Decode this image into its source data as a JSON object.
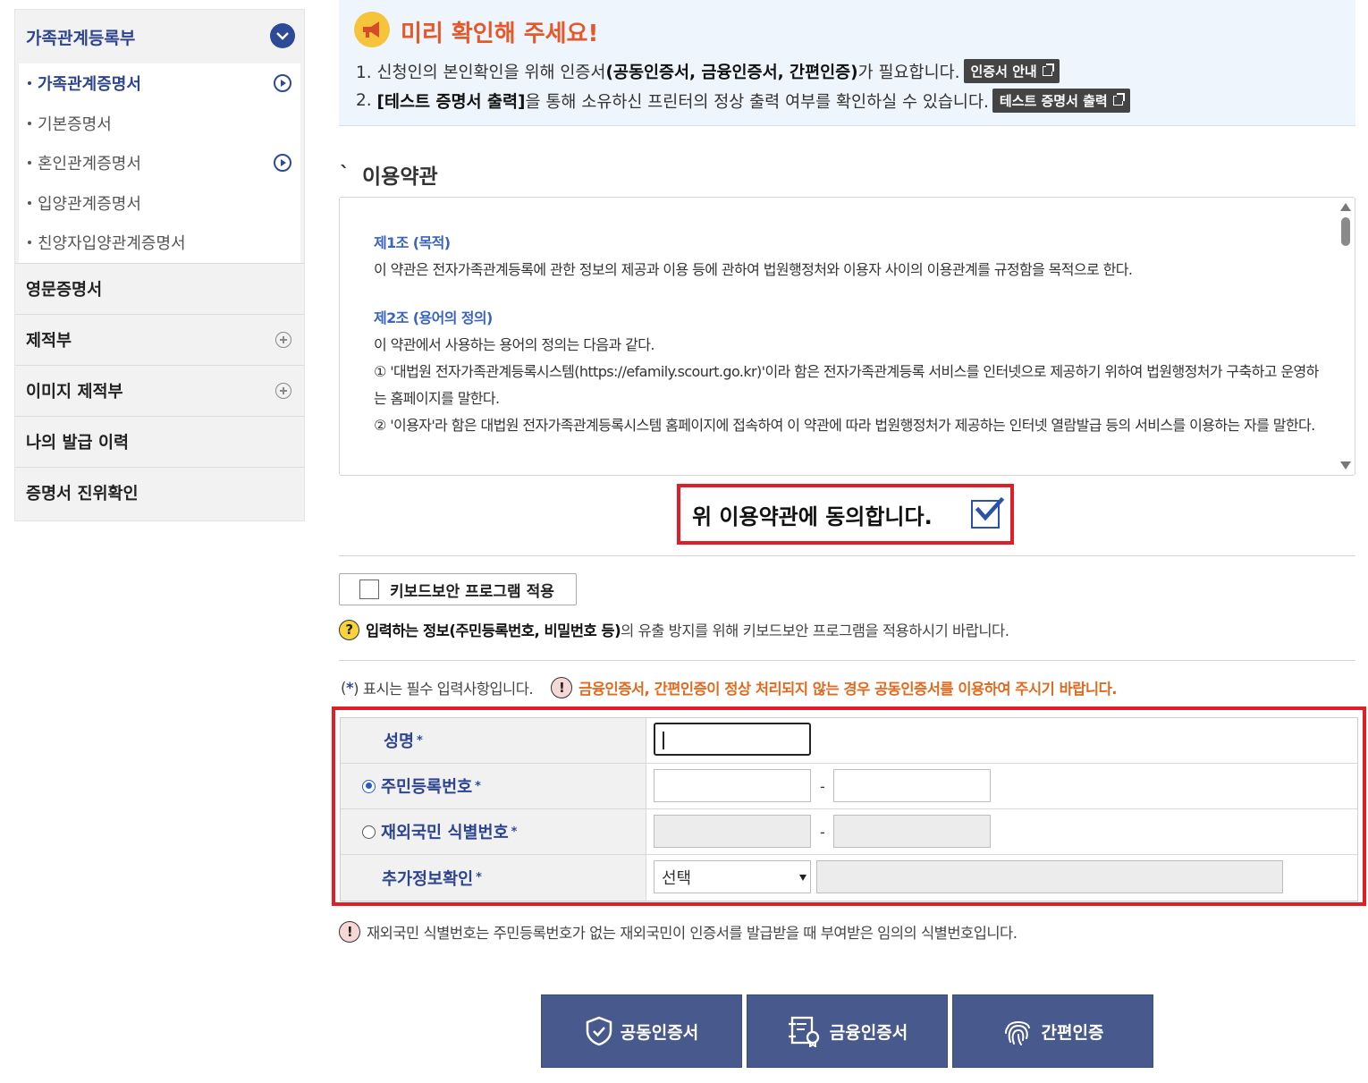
{
  "sidebar": {
    "header": "가족관계등록부",
    "sub_items": [
      {
        "label": "가족관계증명서"
      },
      {
        "label": "기본증명서"
      },
      {
        "label": "혼인관계증명서"
      },
      {
        "label": "입양관계증명서"
      },
      {
        "label": "친양자입양관계증명서"
      }
    ],
    "items": [
      {
        "label": "영문증명서"
      },
      {
        "label": "제적부"
      },
      {
        "label": "이미지 제적부"
      },
      {
        "label": "나의 발급 이력"
      },
      {
        "label": "증명서 진위확인"
      }
    ]
  },
  "notice": {
    "title": "미리 확인해 주세요!",
    "line1_a": "1. 신청인의 본인확인을 위해 인증서",
    "line1_b": "(공동인증서, 금융인증서, 간편인증)",
    "line1_c": "가 필요합니다.",
    "cert_guide_button": "인증서 안내",
    "line2_a": "2.",
    "line2_b": "[테스트 증명서 출력]",
    "line2_c": "을 통해 소유하신 프린터의 정상 출력 여부를 확인하실 수 있습니다.",
    "test_print_button": "테스트 증명서 출력"
  },
  "terms": {
    "section_title": "이용약관",
    "art1_title": "제1조 (목적)",
    "art1_body": "이 약관은 전자가족관계등록에 관한 정보의 제공과 이용 등에 관하여 법원행정처와 이용자 사이의 이용관계를 규정함을 목적으로 한다.",
    "art2_title": "제2조 (용어의 정의)",
    "art2_intro": "이 약관에서 사용하는 용어의 정의는 다음과 같다.",
    "art2_item1": "① '대법원 전자가족관계등록시스템(https://efamily.scourt.go.kr)'이라 함은 전자가족관계등록 서비스를 인터넷으로 제공하기 위하여 법원행정처가 구축하고 운영하는 홈페이지를 말한다.",
    "art2_item2": "② '이용자'라 함은 대법원 전자가족관계등록시스템 홈페이지에 접속하여 이 약관에 따라 법원행정처가 제공하는 인터넷 열람발급 등의 서비스를 이용하는 자를 말한다."
  },
  "agree": {
    "label": "위 이용약관에 동의합니다.",
    "checked": true
  },
  "keyboard": {
    "button_label": "키보드보안 프로그램 적용",
    "note_bold": "입력하는 정보(주민등록번호, 비밀번호 등)",
    "note_rest": "의 유출 방지를 위해 키보드보안 프로그램을 적용하시기 바랍니다."
  },
  "required": {
    "note_a": "(",
    "note_star": "*",
    "note_b": ") 표시는 필수 입력사항입니다.",
    "warning": "금융인증서, 간편인증이 정상 처리되지 않는 경우 공동인증서를 이용하여 주시기 바랍니다."
  },
  "form": {
    "name_label": "성명",
    "rrn_label": "주민등록번호",
    "foreign_label": "재외국민 식별번호",
    "extra_label": "추가정보확인",
    "star": "*",
    "dash": "-",
    "select_value": "선택"
  },
  "foreign_note": "재외국민 식별번호는 주민등록번호가 없는 재외국민이 인증서를 발급받을 때 부여받은 임의의 식별번호입니다.",
  "auth_buttons": [
    {
      "label": "공동인증서"
    },
    {
      "label": "금융인증서"
    },
    {
      "label": "간편인증"
    }
  ],
  "colors": {
    "navy": "#2d4590",
    "accent_red": "#e01e28",
    "warning_orange": "#e06a1f",
    "button_bg": "#485a8d"
  }
}
